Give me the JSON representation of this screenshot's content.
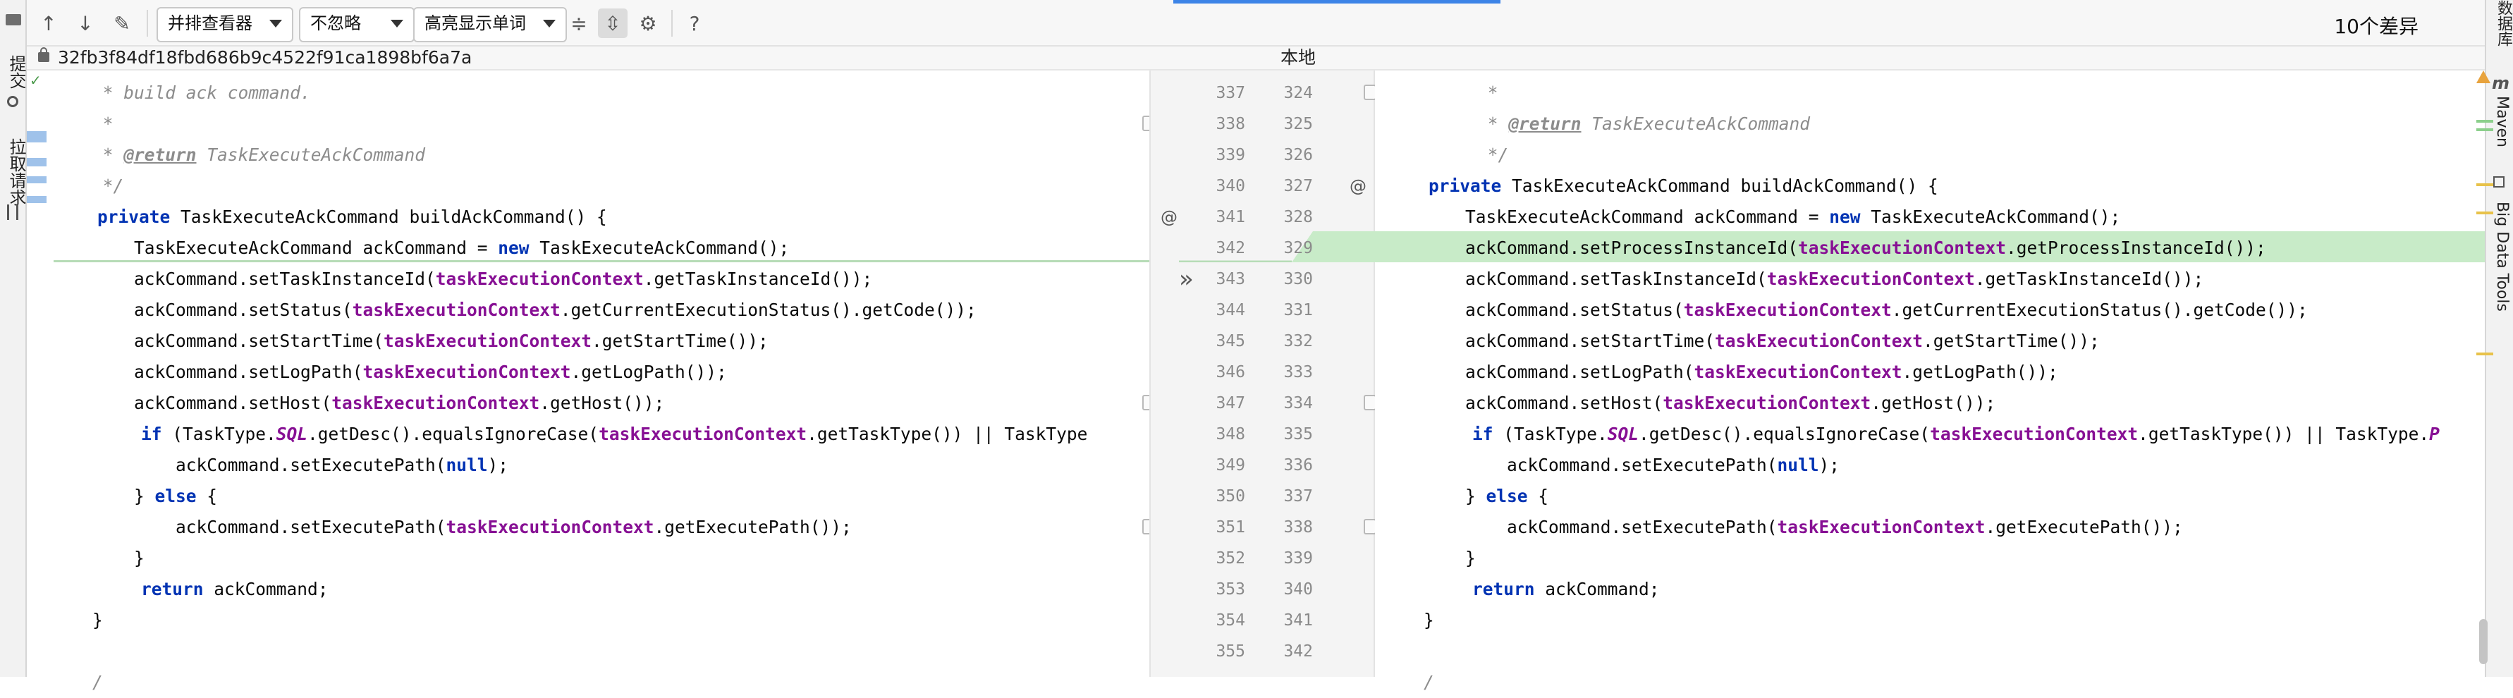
{
  "left_toolstrip": {
    "commit_label": "提交",
    "pull_request_label": "拉取请求"
  },
  "right_toolstrip": {
    "database_label": "数据库",
    "maven_label": "Maven",
    "bigdata_label": "Big Data Tools"
  },
  "toolbar": {
    "viewer_mode": "并排查看器",
    "ignore_mode": "不忽略",
    "highlight_mode": "高亮显示单词",
    "help_label": "?",
    "diff_count": "10个差异"
  },
  "header": {
    "left_revision": "32fb3f84df18fbd686b9c4522f91ca1898bf6a7a",
    "right_revision": "本地"
  },
  "left_line_numbers": [
    "337",
    "338",
    "339",
    "340",
    "341",
    "342",
    "343",
    "344",
    "345",
    "346",
    "347",
    "348",
    "349",
    "350",
    "351",
    "352",
    "353",
    "354",
    "355"
  ],
  "right_line_numbers": [
    "324",
    "325",
    "326",
    "327",
    "328",
    "329",
    "330",
    "331",
    "332",
    "333",
    "334",
    "335",
    "336",
    "337",
    "338",
    "339",
    "340",
    "341",
    "342"
  ],
  "left_code": {
    "l0": "     * build ack command.",
    "l1": "     *",
    "l2a": "     * ",
    "l2tag": "@return",
    "l2b": " TaskExecuteAckCommand",
    "l3": "     */",
    "l4kw": "private",
    "l4b": " TaskExecuteAckCommand buildAckCommand() {",
    "l5a": "        TaskExecuteAckCommand ackCommand = ",
    "l5kw": "new",
    "l5b": " TaskExecuteAckCommand();",
    "l6a": "        ackCommand.setTaskInstanceId(",
    "l6f": "taskExecutionContext",
    "l6b": ".getTaskInstanceId());",
    "l7a": "        ackCommand.setStatus(",
    "l7f": "taskExecutionContext",
    "l7b": ".getCurrentExecutionStatus().getCode());",
    "l8a": "        ackCommand.setStartTime(",
    "l8f": "taskExecutionContext",
    "l8b": ".getStartTime());",
    "l9a": "        ackCommand.setLogPath(",
    "l9f": "taskExecutionContext",
    "l9b": ".getLogPath());",
    "l10a": "        ackCommand.setHost(",
    "l10f": "taskExecutionContext",
    "l10b": ".getHost());",
    "l11kw": "if",
    "l11a": " (TaskType.",
    "l11i": "SQL",
    "l11b": ".getDesc().equalsIgnoreCase(",
    "l11f": "taskExecutionContext",
    "l11c": ".getTaskType()) || TaskType",
    "l12a": "            ackCommand.setExecutePath(",
    "l12kw": "null",
    "l12b": ");",
    "l13a": "        } ",
    "l13kw": "else",
    "l13b": " {",
    "l14a": "            ackCommand.setExecutePath(",
    "l14f": "taskExecutionContext",
    "l14b": ".getExecutePath());",
    "l15": "        }",
    "l16kw": "return",
    "l16b": " ackCommand;",
    "l17": "    }",
    "l18": "    /"
  },
  "right_code": {
    "r0": "     *",
    "r1a": "     * ",
    "r1tag": "@return",
    "r1b": " TaskExecuteAckCommand",
    "r2": "     */",
    "r3kw": "private",
    "r3b": " TaskExecuteAckCommand buildAckCommand() {",
    "r4a": "        TaskExecuteAckCommand ackCommand = ",
    "r4kw": "new",
    "r4b": " TaskExecuteAckCommand();",
    "r5a": "        ackCommand.setProcessInstanceId(",
    "r5f": "taskExecutionContext",
    "r5b": ".getProcessInstanceId());",
    "r6a": "        ackCommand.setTaskInstanceId(",
    "r6f": "taskExecutionContext",
    "r6b": ".getTaskInstanceId());",
    "r7a": "        ackCommand.setStatus(",
    "r7f": "taskExecutionContext",
    "r7b": ".getCurrentExecutionStatus().getCode());",
    "r8a": "        ackCommand.setStartTime(",
    "r8f": "taskExecutionContext",
    "r8b": ".getStartTime());",
    "r9a": "        ackCommand.setLogPath(",
    "r9f": "taskExecutionContext",
    "r9b": ".getLogPath());",
    "r10a": "        ackCommand.setHost(",
    "r10f": "taskExecutionContext",
    "r10b": ".getHost());",
    "r11kw": "if",
    "r11a": " (TaskType.",
    "r11i": "SQL",
    "r11b": ".getDesc().equalsIgnoreCase(",
    "r11f": "taskExecutionContext",
    "r11c": ".getTaskType()) || TaskType.",
    "r11d": "P",
    "r12a": "            ackCommand.setExecutePath(",
    "r12kw": "null",
    "r12b": ");",
    "r13a": "        } ",
    "r13kw": "else",
    "r13b": " {",
    "r14a": "            ackCommand.setExecutePath(",
    "r14f": "taskExecutionContext",
    "r14b": ".getExecutePath());",
    "r15": "        }",
    "r16kw": "return",
    "r16b": " ackCommand;",
    "r17": "    }",
    "r18": "    /"
  },
  "gutter_markers": {
    "override_marker": "@",
    "apply_change": "»"
  },
  "colors": {
    "inserted_bg": "#c8ebc8",
    "keyword": "#0033b3",
    "field": "#871094",
    "accent": "#3d84e7"
  }
}
